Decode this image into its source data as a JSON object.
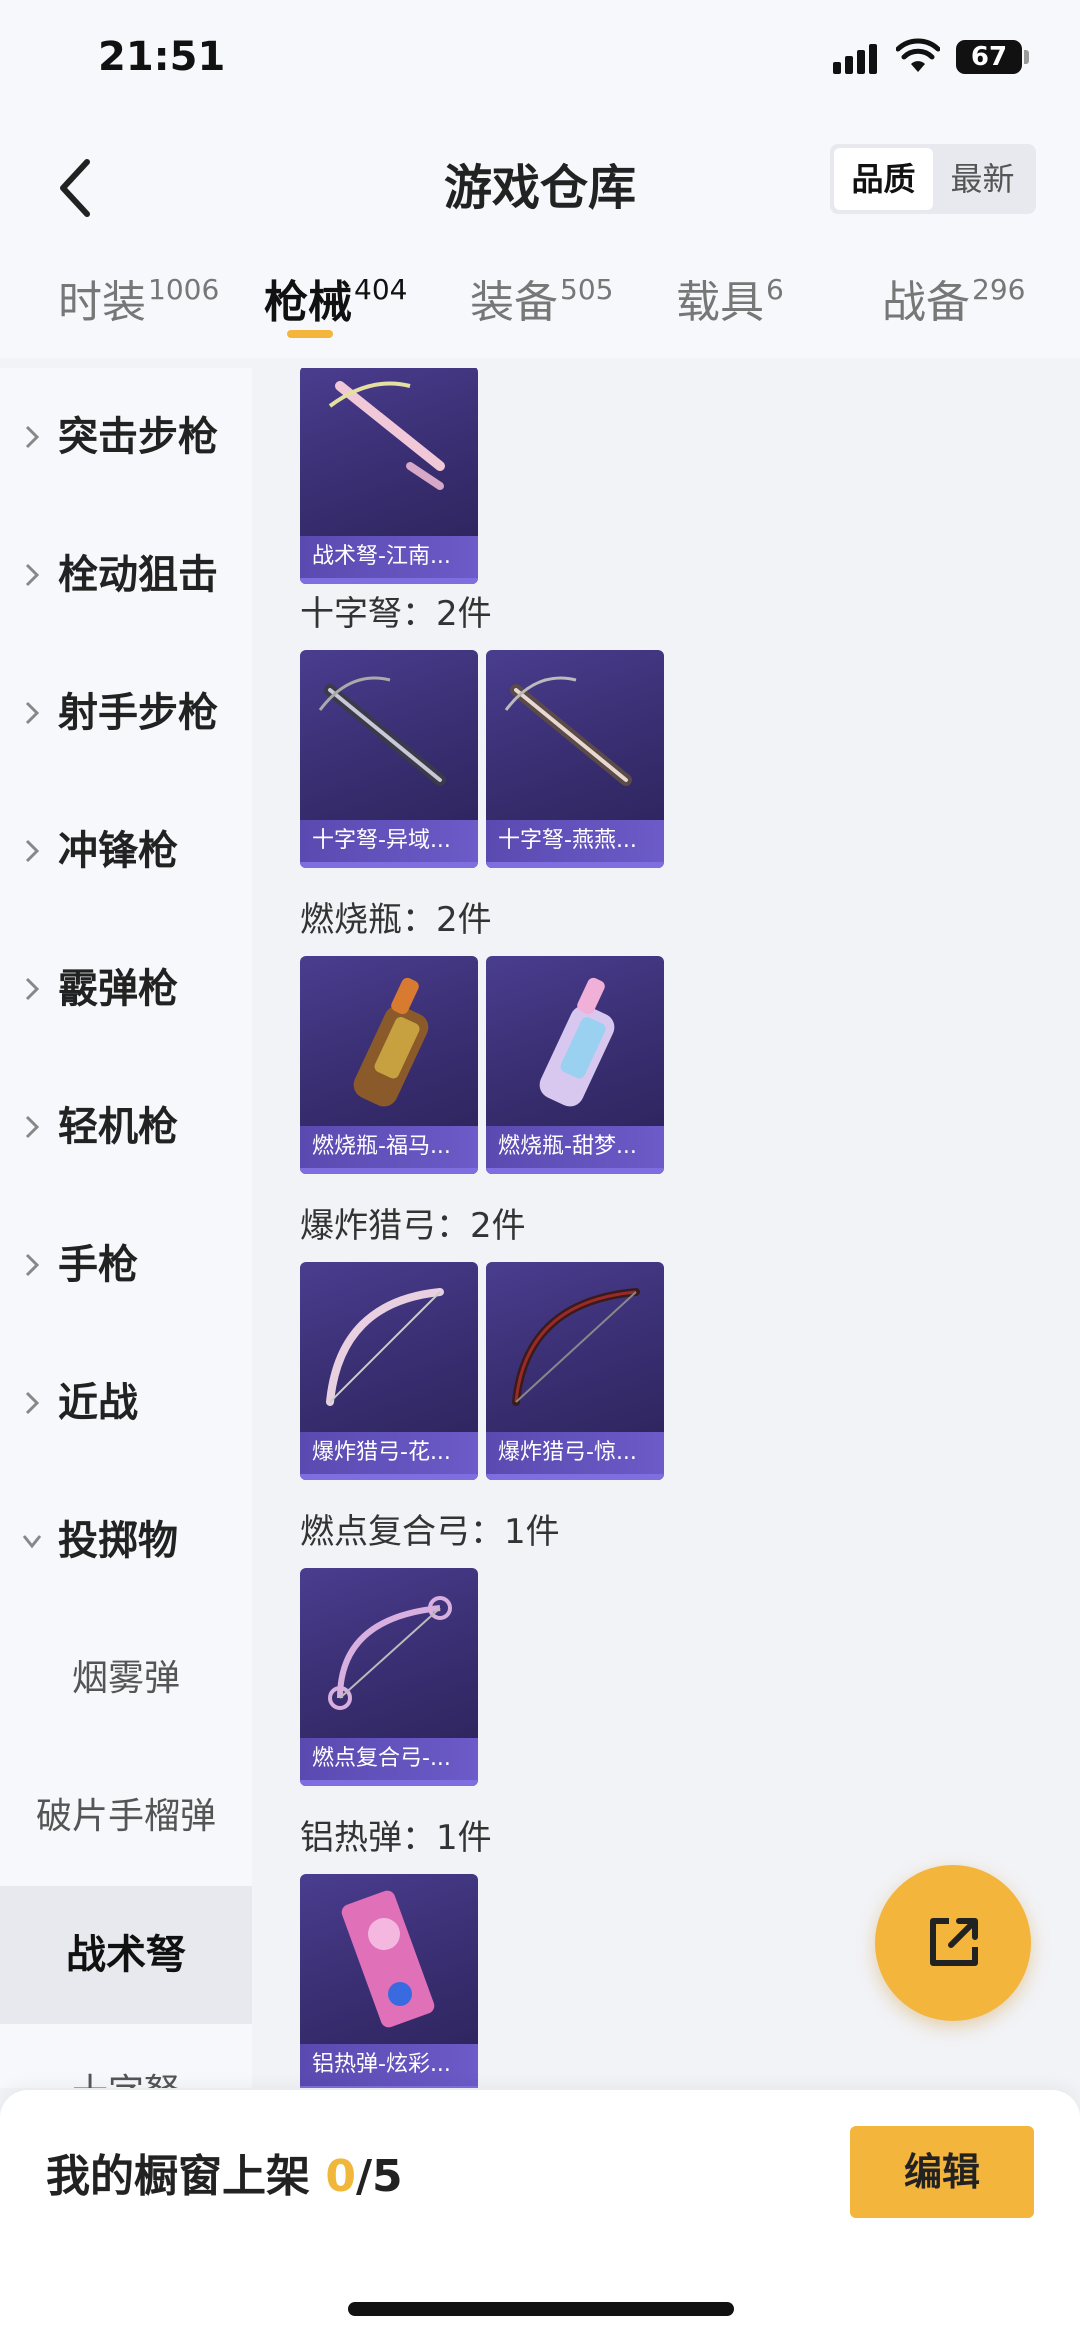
{
  "status_bar": {
    "time": "21:51",
    "battery": "67"
  },
  "header": {
    "title": "游戏仓库",
    "sort_options": [
      "品质",
      "最新"
    ],
    "active_sort": "品质"
  },
  "tabs": [
    {
      "label": "时装",
      "count": "1006"
    },
    {
      "label": "枪械",
      "count": "404"
    },
    {
      "label": "装备",
      "count": "505"
    },
    {
      "label": "载具",
      "count": "6"
    },
    {
      "label": "战备",
      "count": "296"
    }
  ],
  "active_tab": "枪械",
  "sidebar": {
    "categories": [
      "突击步枪",
      "栓动狙击",
      "射手步枪",
      "冲锋枪",
      "霰弹枪",
      "轻机枪",
      "手枪",
      "近战",
      "投掷物"
    ],
    "sub_items": [
      "烟雾弹",
      "破片手榴弹",
      "战术弩",
      "十字弩"
    ],
    "active_sub": "战术弩"
  },
  "content": {
    "top_card": "战术弩-江南...",
    "sections": [
      {
        "title": "十字弩：2件",
        "cards": [
          "十字弩-异域...",
          "十字弩-燕燕..."
        ]
      },
      {
        "title": "燃烧瓶：2件",
        "cards": [
          "燃烧瓶-福马...",
          "燃烧瓶-甜梦..."
        ]
      },
      {
        "title": "爆炸猎弓：2件",
        "cards": [
          "爆炸猎弓-花...",
          "爆炸猎弓-惊..."
        ]
      },
      {
        "title": "燃点复合弓：1件",
        "cards": [
          "燃点复合弓-..."
        ]
      },
      {
        "title": "铝热弹：1件",
        "cards": [
          "铝热弹-炫彩..."
        ]
      }
    ]
  },
  "bottom_bar": {
    "label": "我的橱窗上架",
    "count": "0",
    "total": "/5",
    "edit_label": "编辑"
  },
  "colors": {
    "accent": "#f3b53c",
    "card_bg": "#3a2f73",
    "caption_bg": "#6c5bc8"
  },
  "icons": [
    "back-arrow-icon",
    "chevron-right-icon",
    "chevron-down-icon",
    "share-icon",
    "signal-icon",
    "wifi-icon",
    "battery-icon"
  ]
}
